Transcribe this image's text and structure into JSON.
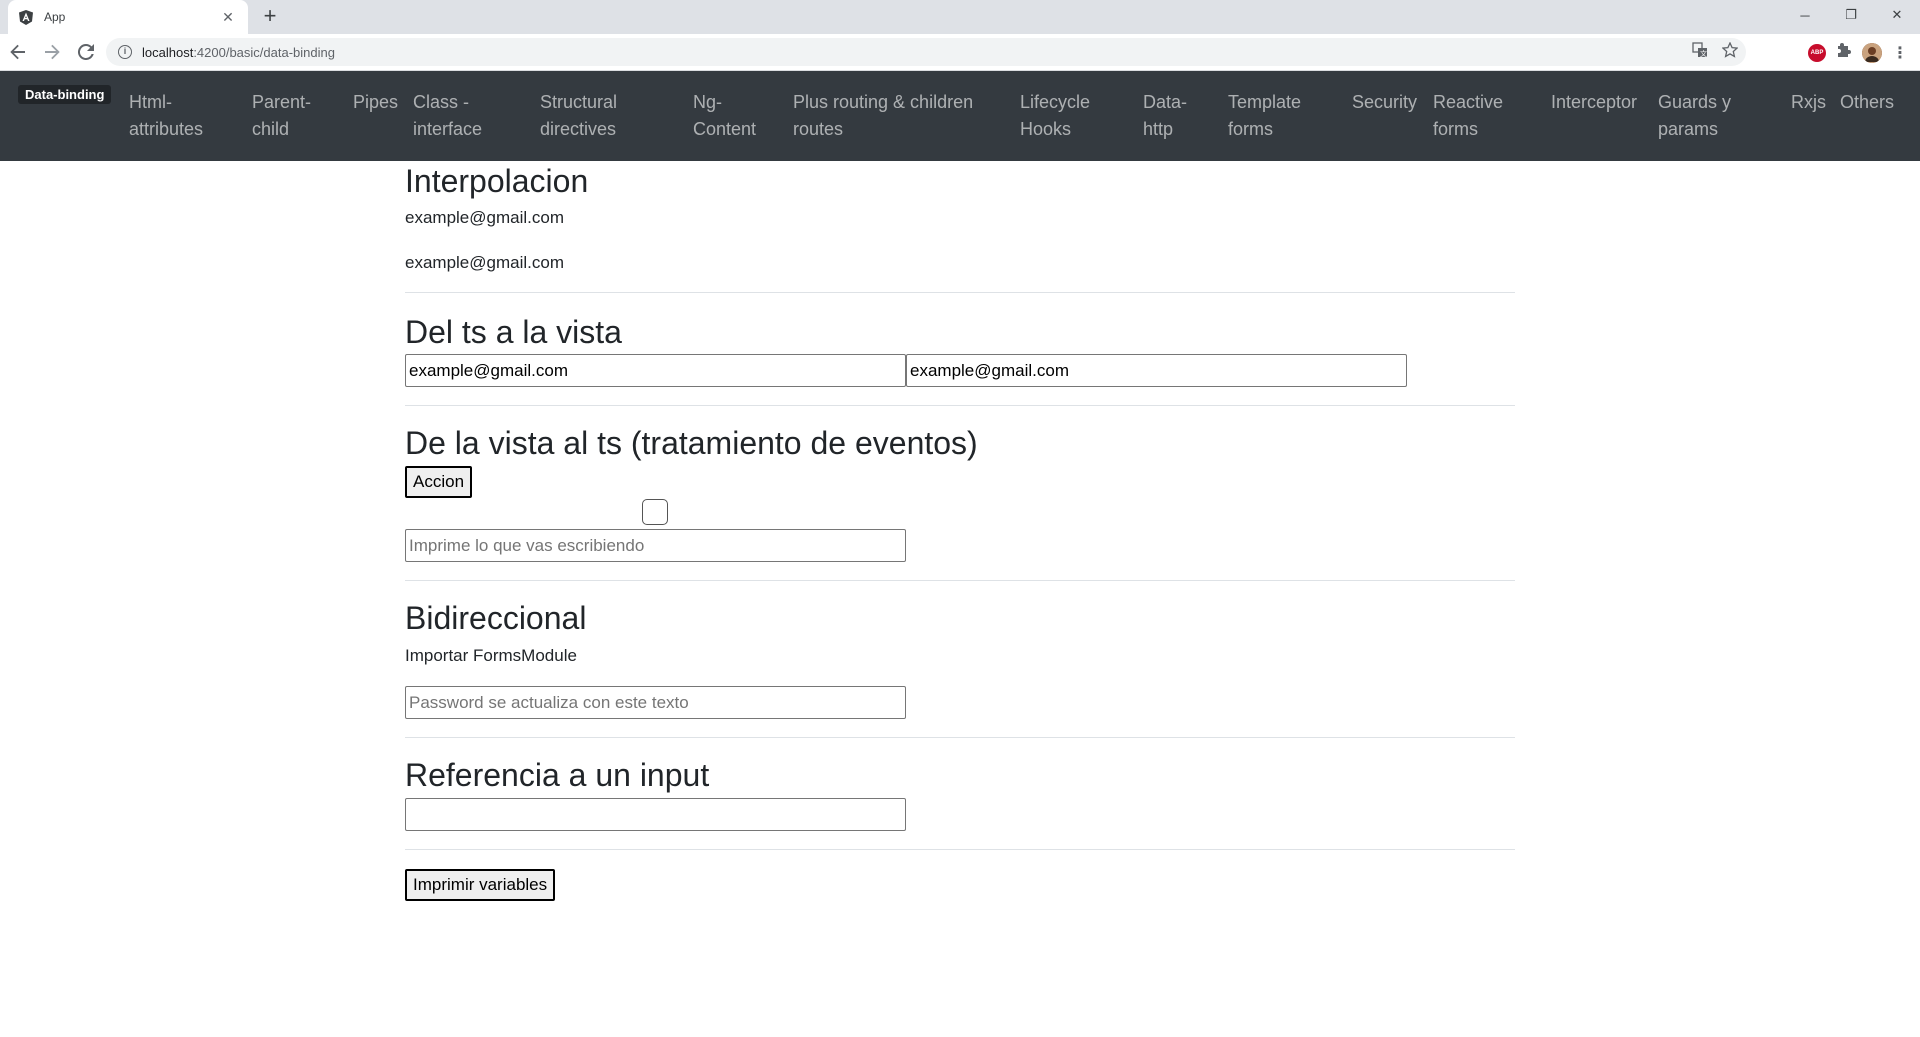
{
  "browser": {
    "tab_title": "App",
    "url_host": "localhost",
    "url_path": ":4200/basic/data-binding"
  },
  "navbar": {
    "brand": "Data-binding",
    "items": [
      "Html-\nattributes",
      "Parent-\nchild",
      "Pipes",
      "Class -\ninterface",
      "Structural\ndirectives",
      "Ng-\nContent",
      "Plus routing & children\nroutes",
      "Lifecycle\nHooks",
      "Data-\nhttp",
      "Template\nforms",
      "Security",
      "Reactive\nforms",
      "Interceptor",
      "Guards y\nparams",
      "Rxjs",
      "Others"
    ]
  },
  "sections": {
    "interpolacion": {
      "title": "Interpolacion",
      "line1": "example@gmail.com",
      "line2": "example@gmail.com"
    },
    "ts_vista": {
      "title": "Del ts a la vista",
      "input1_value": "example@gmail.com",
      "input2_value": "example@gmail.com"
    },
    "vista_ts": {
      "title": "De la vista al ts (tratamiento de eventos)",
      "button_label": "Accion",
      "input_placeholder": "Imprime lo que vas escribiendo"
    },
    "bidireccional": {
      "title": "Bidireccional",
      "text": "Importar FormsModule",
      "input_placeholder": "Password se actualiza con este texto"
    },
    "referencia": {
      "title": "Referencia a un input",
      "input_value": ""
    },
    "print_button_label": "Imprimir variables"
  }
}
